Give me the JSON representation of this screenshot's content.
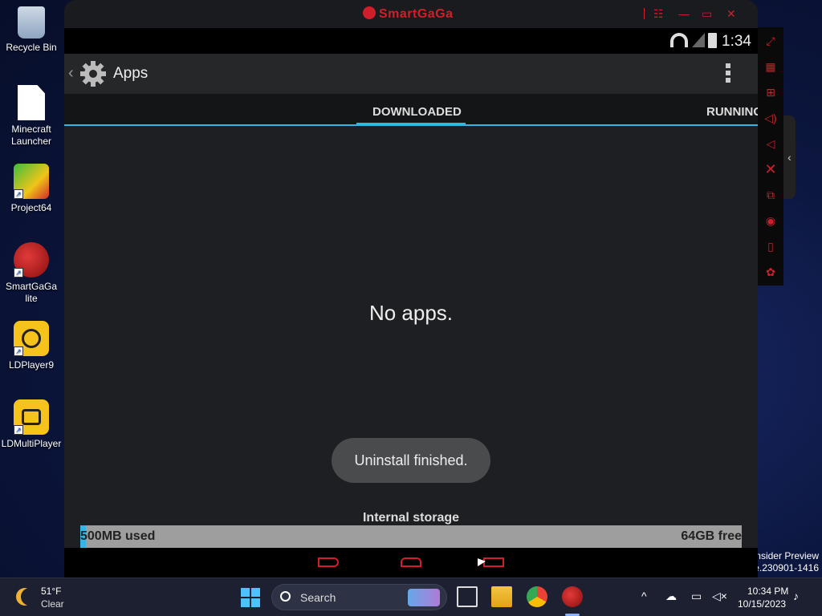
{
  "desktop": {
    "icons": [
      {
        "label": "Recycle Bin"
      },
      {
        "label": "Minecraft Launcher"
      },
      {
        "label": "Project64"
      },
      {
        "label": "SmartGaGa lite"
      },
      {
        "label": "LDPlayer9"
      },
      {
        "label": "LDMultiPlayer"
      }
    ],
    "watermark_line1": "nsider Preview",
    "watermark_line2": "ase.230901-1416"
  },
  "emulator": {
    "app_name": "SmartGaGa",
    "status_time": "1:34",
    "action_bar_title": "Apps",
    "tabs": [
      {
        "label": "DOWNLOADED",
        "active": true
      },
      {
        "label": "RUNNING",
        "active": false
      }
    ],
    "empty_message": "No apps.",
    "toast": "Uninstall finished.",
    "storage": {
      "label": "Internal storage",
      "used": "500MB used",
      "free": "64GB free",
      "used_fraction": 0.008
    },
    "accent_color": "#33b5e5",
    "brand_color": "#d01f2a",
    "sidebar_icons": [
      "fullscreen-icon",
      "keyboard-icon",
      "apk-install-icon",
      "volume-up-icon",
      "volume-down-icon",
      "close-app-icon",
      "multi-instance-icon",
      "location-icon",
      "shake-icon",
      "settings-icon"
    ]
  },
  "taskbar": {
    "weather_temp": "51°F",
    "weather_cond": "Clear",
    "search_placeholder": "Search",
    "clock_time": "10:34 PM",
    "clock_date": "10/15/2023"
  }
}
